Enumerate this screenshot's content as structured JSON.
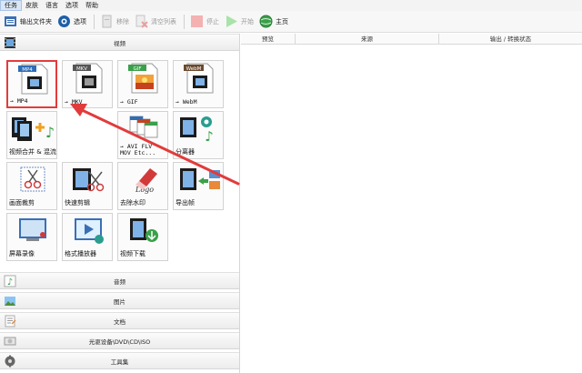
{
  "menubar": {
    "items": [
      "任务",
      "皮肤",
      "语言",
      "选项",
      "帮助"
    ]
  },
  "toolbar": {
    "output_folder": "输出文件夹",
    "options": "选项",
    "remove": "移除",
    "clear_list": "清空列表",
    "stop": "停止",
    "start": "开始",
    "home": "主页"
  },
  "categories": {
    "video": "视频",
    "audio": "音频",
    "image": "图片",
    "document": "文档",
    "optical": "光驱设备\\DVD\\CD\\ISO",
    "tools": "工具集"
  },
  "tiles": {
    "mp4": {
      "badge": "MP4",
      "label": "→ MP4"
    },
    "mkv": {
      "badge": "MKV",
      "label": "→ MKV"
    },
    "gif": {
      "badge": "GIF",
      "label": "→ GIF"
    },
    "webm": {
      "badge": "WebM",
      "label": "→ WebM"
    },
    "merge": {
      "label": "视频合并 & 混流"
    },
    "avi": {
      "label_line1": "→ AVI FLV",
      "label_line2": "MOV Etc..."
    },
    "splitter": {
      "label": "分离器"
    },
    "crop": {
      "label": "画面裁剪"
    },
    "quick_cut": {
      "label": "快速剪辑"
    },
    "watermark": {
      "label": "去除水印",
      "logo_text": "Logo"
    },
    "export_frames": {
      "label": "导出帧"
    },
    "screen_record": {
      "label": "屏幕录像"
    },
    "player": {
      "label": "格式播放器"
    },
    "download": {
      "label": "视频下载"
    }
  },
  "file_list": {
    "columns": [
      "预览",
      "来源",
      "输出 / 转换状态"
    ]
  },
  "colors": {
    "highlight_border": "#e23b3b",
    "annotation_arrow": "#e23b3b"
  }
}
